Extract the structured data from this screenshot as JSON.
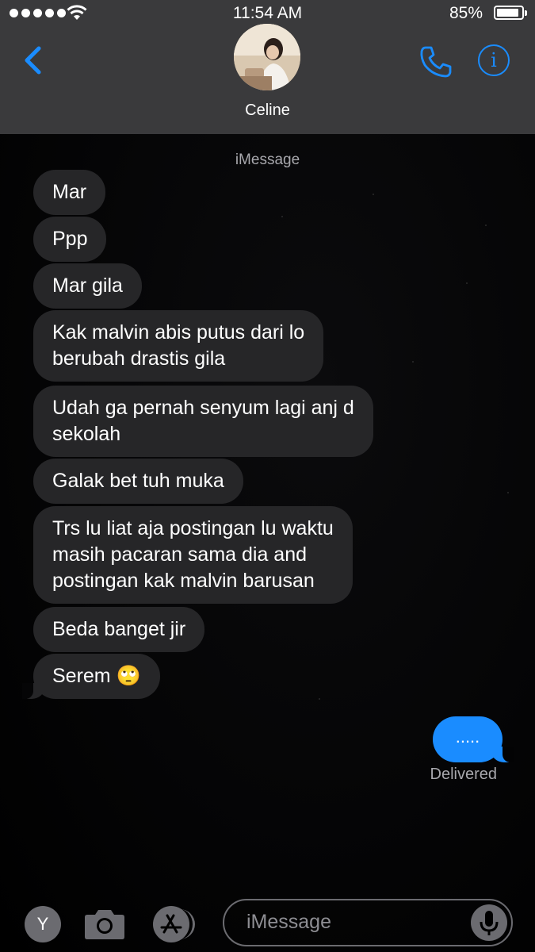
{
  "status_bar": {
    "time": "11:54 AM",
    "battery_percent": "85%",
    "battery_level": 0.85,
    "signal_bars": 5
  },
  "header": {
    "contact_name": "Celine",
    "icons": {
      "back": "chevron-left-icon",
      "call": "phone-icon",
      "info": "info-icon"
    },
    "accent_color": "#1a8cff"
  },
  "conversation": {
    "service_label": "iMessage",
    "incoming": [
      "Mar",
      "Ppp",
      "Mar gila",
      "Kak malvin abis putus dari lo\nberubah drastis gila",
      "Udah ga pernah senyum lagi anj d\nsekolah",
      "Galak bet tuh muka",
      "Trs lu liat aja postingan lu waktu\nmasih pacaran sama dia and\npostingan kak malvin barusan",
      "Beda banget jir",
      "Serem 🙄"
    ],
    "outgoing": [
      "....."
    ],
    "delivery_status": "Delivered",
    "incoming_bubble_color": "#262628",
    "outgoing_bubble_color": "#1a8cff"
  },
  "input_bar": {
    "placeholder": "iMessage",
    "apps_button_letter": "Y",
    "icons": {
      "apps": "apps-drawer-icon",
      "camera": "camera-icon",
      "app_store": "app-store-icon",
      "mic": "microphone-icon"
    }
  }
}
